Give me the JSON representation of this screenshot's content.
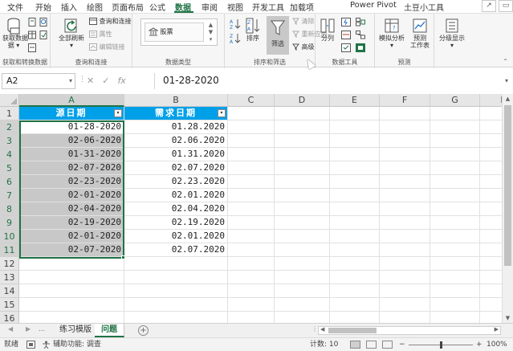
{
  "ribbon_tabs": [
    "文件",
    "开始",
    "插入",
    "绘图",
    "页面布局",
    "公式",
    "数据",
    "审阅",
    "视图",
    "开发工具",
    "加载项",
    "Power Pivot",
    "土豆小工具"
  ],
  "active_tab": "数据",
  "window_controls": [
    "share-icon",
    "comment-icon"
  ],
  "ribbon": {
    "get_transform": {
      "get_data": "获取数据",
      "get_data_line2": "据 ▾",
      "label": "获取和转换数据"
    },
    "queries": {
      "refresh_all": "全部刷新",
      "refresh_all_line2": "▾",
      "queries_connections": "查询和连接",
      "properties": "属性",
      "edit_links": "编辑链接",
      "label": "查询和连接"
    },
    "data_types": {
      "stocks": "股票",
      "label": "数据类型"
    },
    "sort_filter": {
      "sort": "排序",
      "filter": "筛选",
      "clear": "清除",
      "reapply": "重新应用",
      "advanced": "高级",
      "label": "排序和筛选"
    },
    "data_tools": {
      "text_to_columns": "分列",
      "label": "数据工具"
    },
    "forecast": {
      "what_if": "模拟分析",
      "what_if_line2": "▾",
      "forecast_sheet": "预测",
      "forecast_sheet_line2": "工作表",
      "label": "预测"
    },
    "outline": {
      "outline": "分级显示",
      "outline_line2": "▾"
    }
  },
  "formula_bar": {
    "name_box": "A2",
    "content": "01-28-2020",
    "fx": "fx"
  },
  "columns": [
    "A",
    "B",
    "C",
    "D",
    "E",
    "F",
    "G",
    "H"
  ],
  "rows": [
    "1",
    "2",
    "3",
    "4",
    "5",
    "6",
    "7",
    "8",
    "9",
    "10",
    "11",
    "12",
    "13",
    "14",
    "15",
    "16"
  ],
  "table": {
    "header_a": "源日期",
    "header_b": "需求日期",
    "col_a": [
      "01-28-2020",
      "02-06-2020",
      "01-31-2020",
      "02-07-2020",
      "02-23-2020",
      "02-01-2020",
      "02-04-2020",
      "02-19-2020",
      "02-01-2020",
      "02-07-2020"
    ],
    "col_b": [
      "01.28.2020",
      "02.06.2020",
      "01.31.2020",
      "02.07.2020",
      "02.23.2020",
      "02.01.2020",
      "02.04.2020",
      "02.19.2020",
      "02.01.2020",
      "02.07.2020"
    ]
  },
  "sheets": [
    "练习模版",
    "问题"
  ],
  "active_sheet": "问题",
  "status": {
    "ready": "就绪",
    "accessibility": "辅助功能: 调查",
    "count": "计数: 10",
    "zoom": "100%",
    "zoom_percent": 100
  },
  "colors": {
    "accent": "#217346",
    "header_fill": "#00a0e9",
    "selection_fill": "#c8c8c8"
  }
}
